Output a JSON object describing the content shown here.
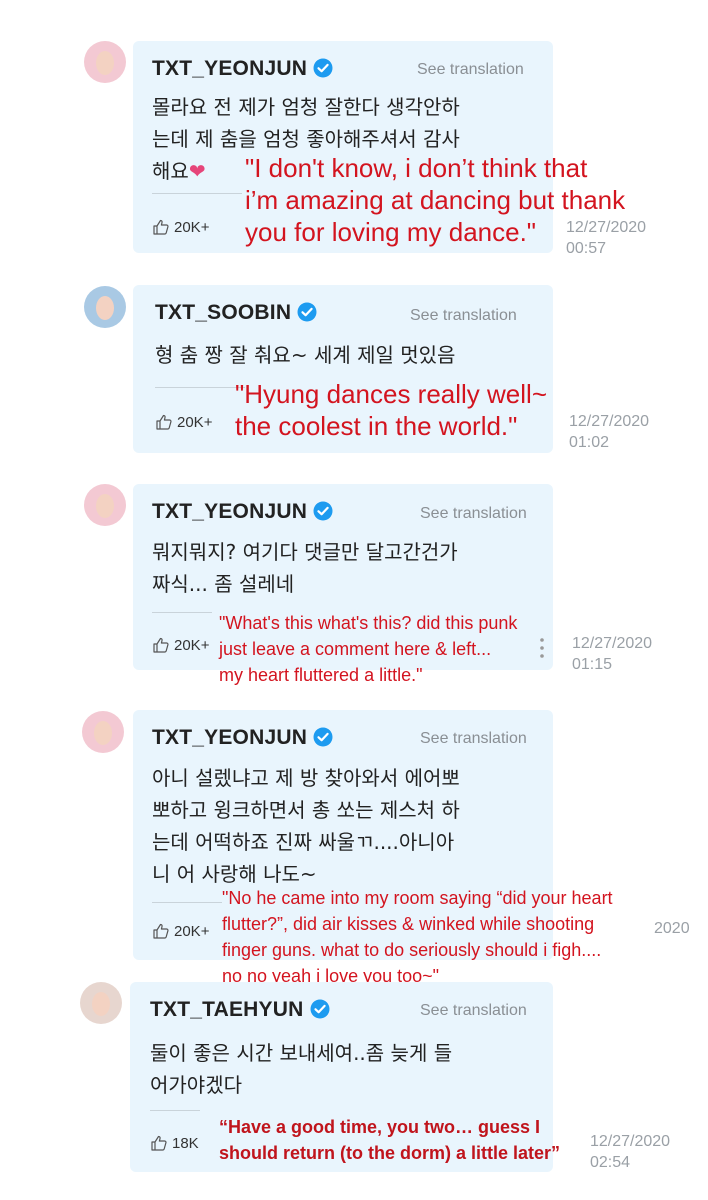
{
  "see_translation": "See translation",
  "likes_full": "20K+",
  "comments": [
    {
      "username": "TXT_YEONJUN",
      "avatar_color": "#f3c9d3",
      "text": "몰라요 전 제가 엄청 잘한다 생각안하\n는데 제 춤을 엄청 좋아해주셔서 감사\n해요",
      "heart": "❤",
      "likes": "20K+",
      "date": "12/27/2020",
      "time": "00:57",
      "translation": "\"I don't know, i don’t think that\ni’m amazing at dancing but thank\nyou for loving my dance.\""
    },
    {
      "username": "TXT_SOOBIN",
      "avatar_color": "#a9c9e4",
      "text": "형 춤 짱 잘 춰요~ 세계 제일 멋있음",
      "likes": "20K+",
      "date": "12/27/2020",
      "time": "01:02",
      "translation": "\"Hyung dances really well~\nthe coolest in the world.\""
    },
    {
      "username": "TXT_YEONJUN",
      "avatar_color": "#f3c9d3",
      "text": "뭐지뭐지? 여기다 댓글만 달고간건가\n짜식... 좀 설레네",
      "likes": "20K+",
      "date": "12/27/2020",
      "time": "01:15",
      "translation": "\"What's this what's this? did this punk\njust leave a comment here & left...\nmy heart fluttered a little.\""
    },
    {
      "username": "TXT_YEONJUN",
      "avatar_color": "#f3c9d3",
      "text": "아니 설렜냐고 제 방 찾아와서 에어뽀\n뽀하고 윙크하면서 총 쏘는 제스처 하\n는데 어떡하죠 진짜 싸울ㄲ....아니아\n니 어 사랑해 나도~",
      "likes": "20K+",
      "date_partial": "2020",
      "translation": "\"No he came into my room saying “did your heart\nflutter?”, did air kisses & winked while shooting\nfinger guns. what to do seriously should i figh....\nno no yeah i love you too~\""
    },
    {
      "username": "TXT_TAEHYUN",
      "avatar_color": "#e7d6cf",
      "text": "둘이 좋은 시간 보내세여..좀 늦게 들\n어가야겠다",
      "likes": "18K",
      "date": "12/27/2020",
      "time": "02:54",
      "translation": "“Have a good time, you two… guess I\nshould return (to the dorm) a little later”"
    }
  ],
  "colors": {
    "card_bg": "#e9f5fd",
    "verified": "#1d9bf0",
    "translation_red": "#d3141f",
    "heart": "#e6457a"
  },
  "icons": [
    "verified-badge-icon",
    "thumbs-up-icon",
    "more-vertical-icon"
  ]
}
